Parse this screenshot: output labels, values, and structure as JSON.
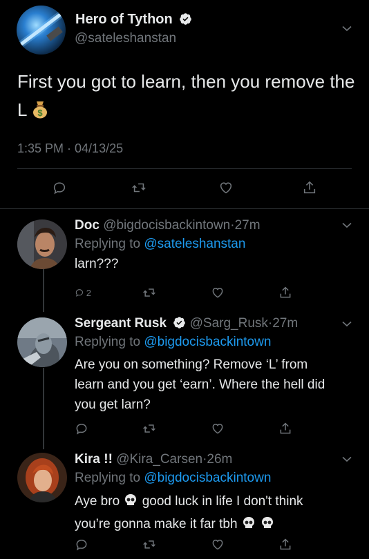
{
  "main_tweet": {
    "display_name": "Hero of Tython",
    "handle": "@sateleshanstan",
    "text": "First you got to learn, then you remove the L",
    "emoji": "money-bag",
    "timestamp": "1:35 PM · 04/13/25"
  },
  "replies": [
    {
      "display_name": "Doc",
      "handle": "@bigdocisbackintown",
      "time": "27m",
      "replying_label": "Replying to",
      "replying_handle": "@sateleshanstan",
      "text": "larn???",
      "reply_count": "2"
    },
    {
      "display_name": "Sergeant Rusk",
      "handle": "@Sarg_Rusk",
      "time": "27m",
      "replying_label": "Replying to",
      "replying_handle": "@bigdocisbackintown",
      "text_lines": [
        "Are you on something? Remove ‘L’ from",
        "learn and you get ‘earn’. Where the hell did",
        "you get larn?"
      ]
    },
    {
      "display_name": "Kira !!",
      "handle": "@Kira_Carsen",
      "time": "26m",
      "replying_label": "Replying to",
      "replying_handle": "@bigdocisbackintown",
      "text_a": "Aye bro",
      "text_b": "good luck in life I don't think",
      "text_c": "you’re gonna make it far tbh"
    }
  ],
  "separator": "·",
  "colors": {
    "background": "#000000",
    "text": "#e7e9ea",
    "secondary": "#71767b",
    "link": "#1d9bf0",
    "divider": "#2f3336"
  }
}
